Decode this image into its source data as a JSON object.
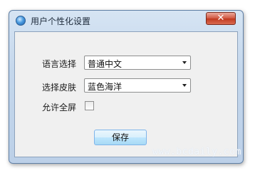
{
  "window": {
    "title": "用户个性化设置",
    "close_symbol": "✕"
  },
  "language": {
    "label": "语言选择",
    "value": "普通中文"
  },
  "skin": {
    "label": "选择皮肤",
    "value": "蓝色海洋"
  },
  "fullscreen": {
    "label": "允许全屏",
    "checked": false
  },
  "buttons": {
    "save_label": "保存"
  },
  "watermark": {
    "text": "www.bcdaily.com"
  }
}
